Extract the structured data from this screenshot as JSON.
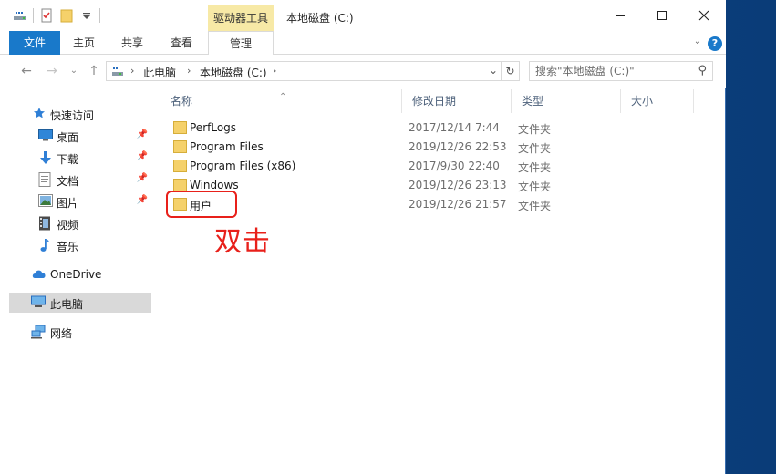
{
  "window": {
    "title": "本地磁盘 (C:)",
    "context_tab": "驱动器工具"
  },
  "ribbon": {
    "tabs": [
      "文件",
      "主页",
      "共享",
      "查看",
      "管理"
    ],
    "help": "?"
  },
  "address": {
    "crumbs": [
      "此电脑",
      "本地磁盘 (C:)"
    ],
    "search_placeholder": "搜索\"本地磁盘 (C:)\""
  },
  "nav": {
    "quick_access": "快速访问",
    "items": [
      {
        "label": "桌面",
        "icon": "desktop-icon",
        "pinned": true
      },
      {
        "label": "下载",
        "icon": "download-icon",
        "pinned": true
      },
      {
        "label": "文档",
        "icon": "document-icon",
        "pinned": true
      },
      {
        "label": "图片",
        "icon": "picture-icon",
        "pinned": true
      },
      {
        "label": "视频",
        "icon": "video-icon",
        "pinned": false
      },
      {
        "label": "音乐",
        "icon": "music-icon",
        "pinned": false
      }
    ],
    "onedrive": "OneDrive",
    "this_pc": "此电脑",
    "network": "网络"
  },
  "list": {
    "columns": [
      "名称",
      "修改日期",
      "类型",
      "大小"
    ],
    "rows": [
      {
        "name": "PerfLogs",
        "date": "2017/12/14 7:44",
        "type": "文件夹"
      },
      {
        "name": "Program Files",
        "date": "2019/12/26 22:53",
        "type": "文件夹"
      },
      {
        "name": "Program Files (x86)",
        "date": "2017/9/30 22:40",
        "type": "文件夹"
      },
      {
        "name": "Windows",
        "date": "2019/12/26 23:13",
        "type": "文件夹"
      },
      {
        "name": "用户",
        "date": "2019/12/26 21:57",
        "type": "文件夹"
      }
    ]
  },
  "annotation": "双击",
  "colors": {
    "accent": "#1979ca",
    "context_tab": "#f7e9a6",
    "annotation": "#e8201a",
    "folder": "#f5d16a",
    "selected": "#d9d9d9"
  }
}
